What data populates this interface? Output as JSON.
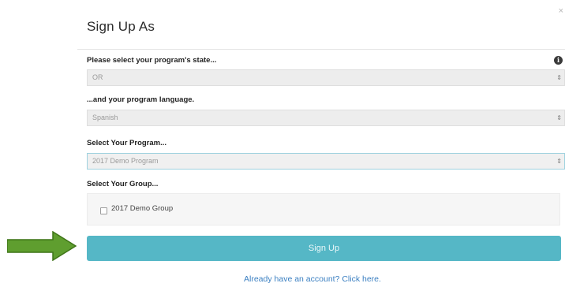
{
  "modal": {
    "title": "Sign Up As",
    "close_glyph": "×"
  },
  "state": {
    "label": "Please select your program's state...",
    "value": "OR",
    "info_glyph": "i"
  },
  "language": {
    "label": "...and your program language.",
    "value": "Spanish"
  },
  "program": {
    "label": "Select Your Program...",
    "value": "2017 Demo Program"
  },
  "group": {
    "label": "Select Your Group...",
    "options": [
      {
        "label": "2017 Demo Group",
        "checked": false
      }
    ]
  },
  "signup_button": {
    "label": "Sign Up"
  },
  "login_link": {
    "label": "Already have an account? Click here."
  },
  "select_caret_glyph": "⇕",
  "colors": {
    "button": "#55b7c6",
    "arrow": "#5f9e2f",
    "link": "#3a7fc1"
  },
  "icons": {
    "arrow": "green-arrow-icon",
    "info": "info-icon",
    "close": "close-icon",
    "checkbox": "checkbox-icon",
    "caret": "select-caret-icon"
  }
}
